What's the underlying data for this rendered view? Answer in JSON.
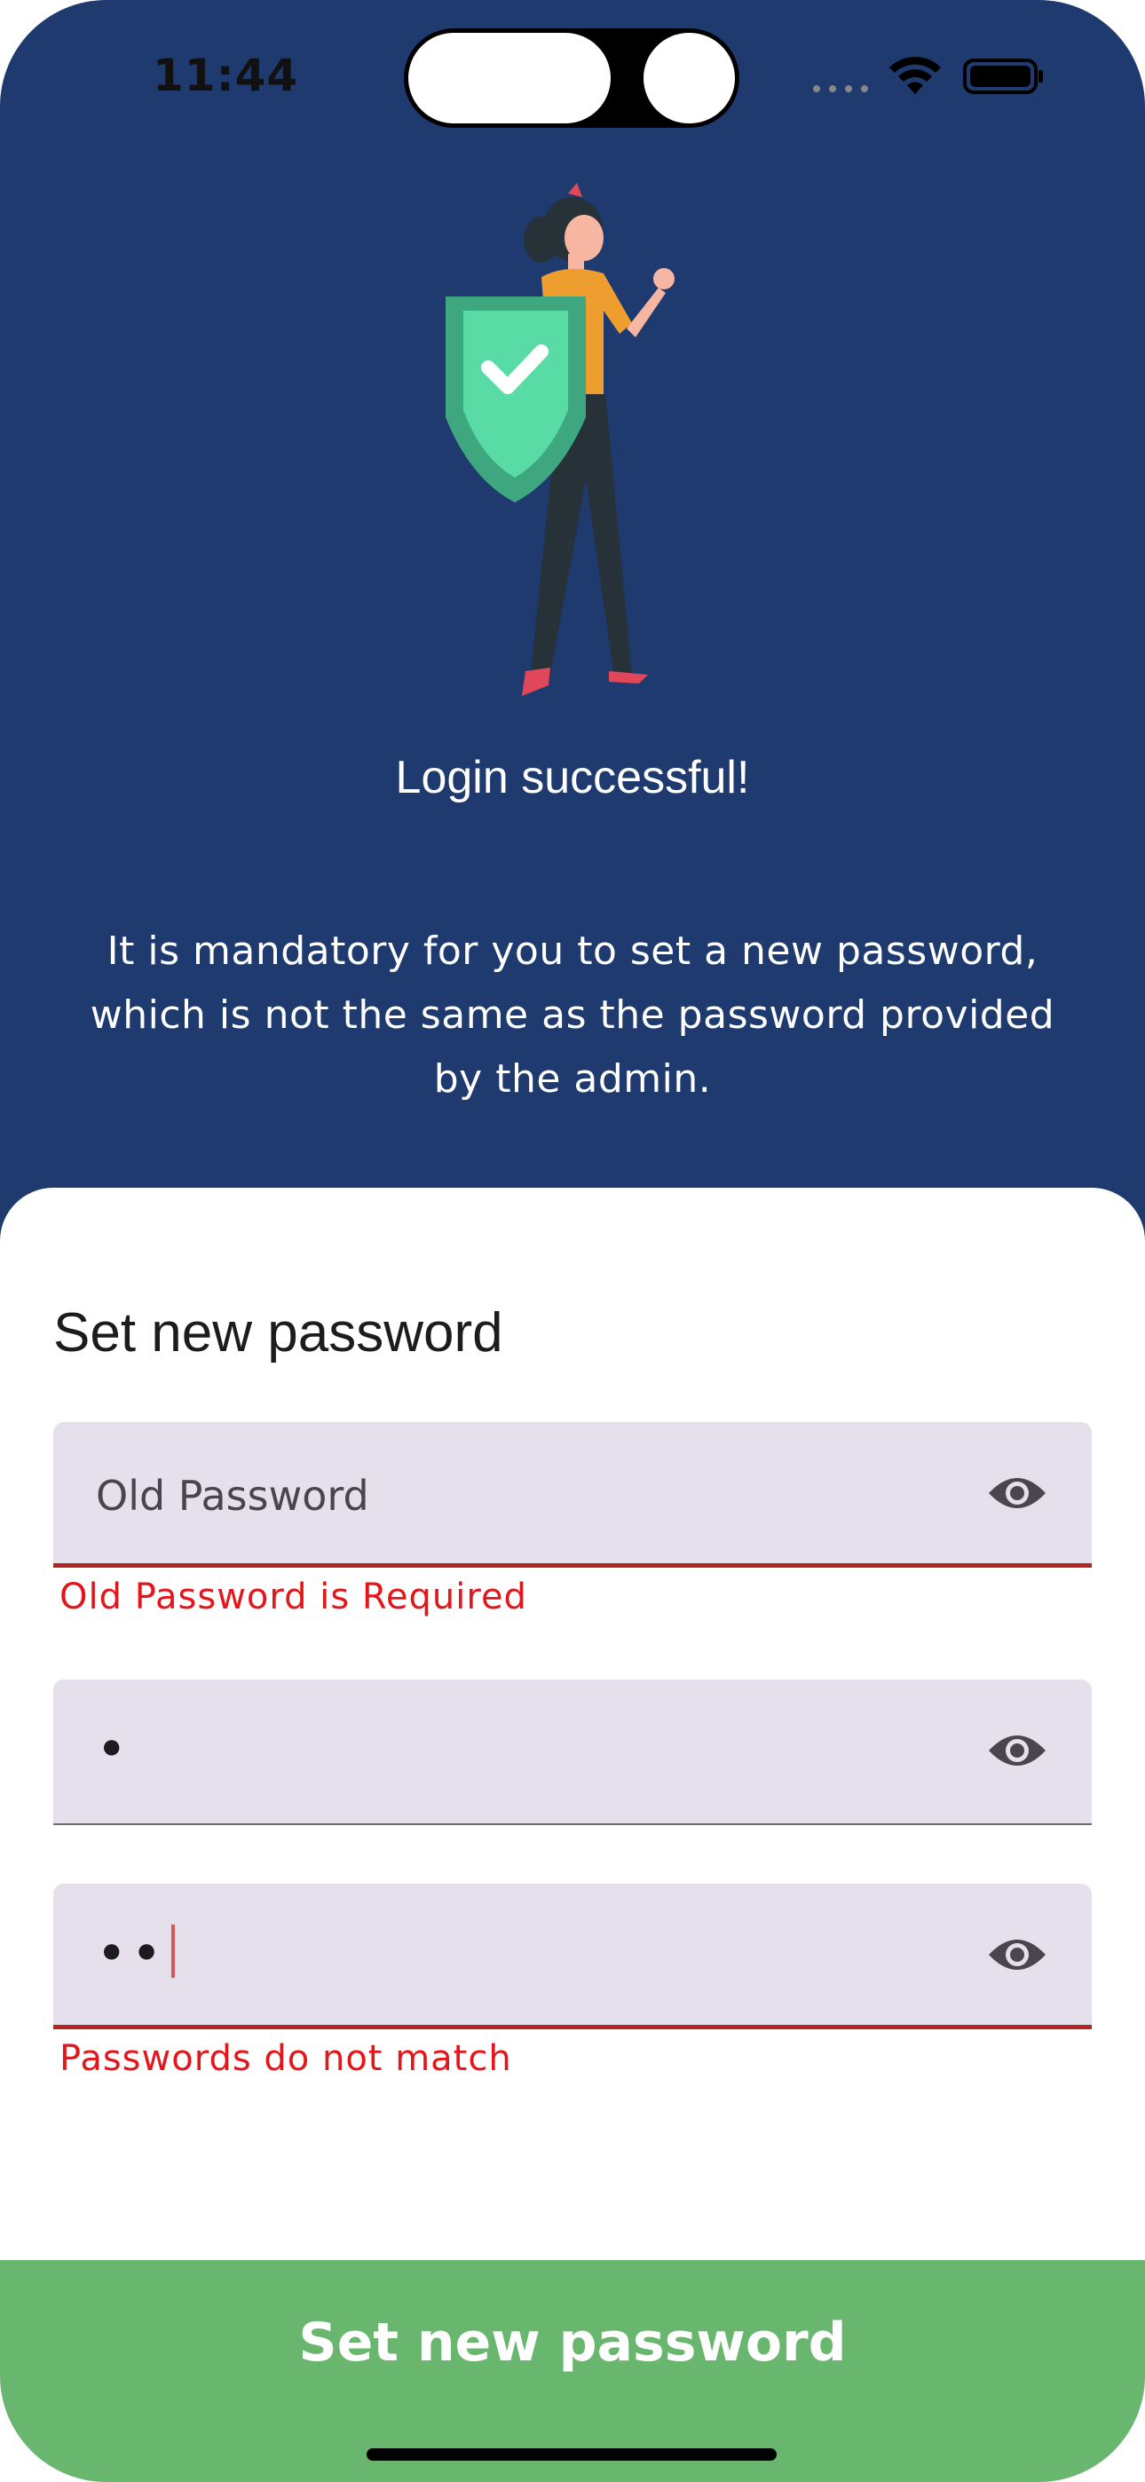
{
  "status_bar": {
    "time": "11:44"
  },
  "hero": {
    "illustration": "woman-with-shield-checkmark",
    "headline": "Login successful!",
    "description": "It is mandatory for you to set a new password, which is not the same as the password provided by the admin."
  },
  "form": {
    "title": "Set new password",
    "old_password": {
      "placeholder": "Old Password",
      "value": "",
      "error": "Old Password is Required",
      "icon": "eye-icon"
    },
    "new_password": {
      "value": "•",
      "icon": "eye-icon"
    },
    "confirm_password": {
      "value": "••",
      "error": "Passwords do not match",
      "icon": "eye-icon"
    }
  },
  "submit_button": {
    "label": "Set new password"
  },
  "colors": {
    "header_bg": "#1E3A6E",
    "field_bg": "#E6DFEC",
    "error": "#E3161B",
    "button_bg": "#69B66E"
  }
}
